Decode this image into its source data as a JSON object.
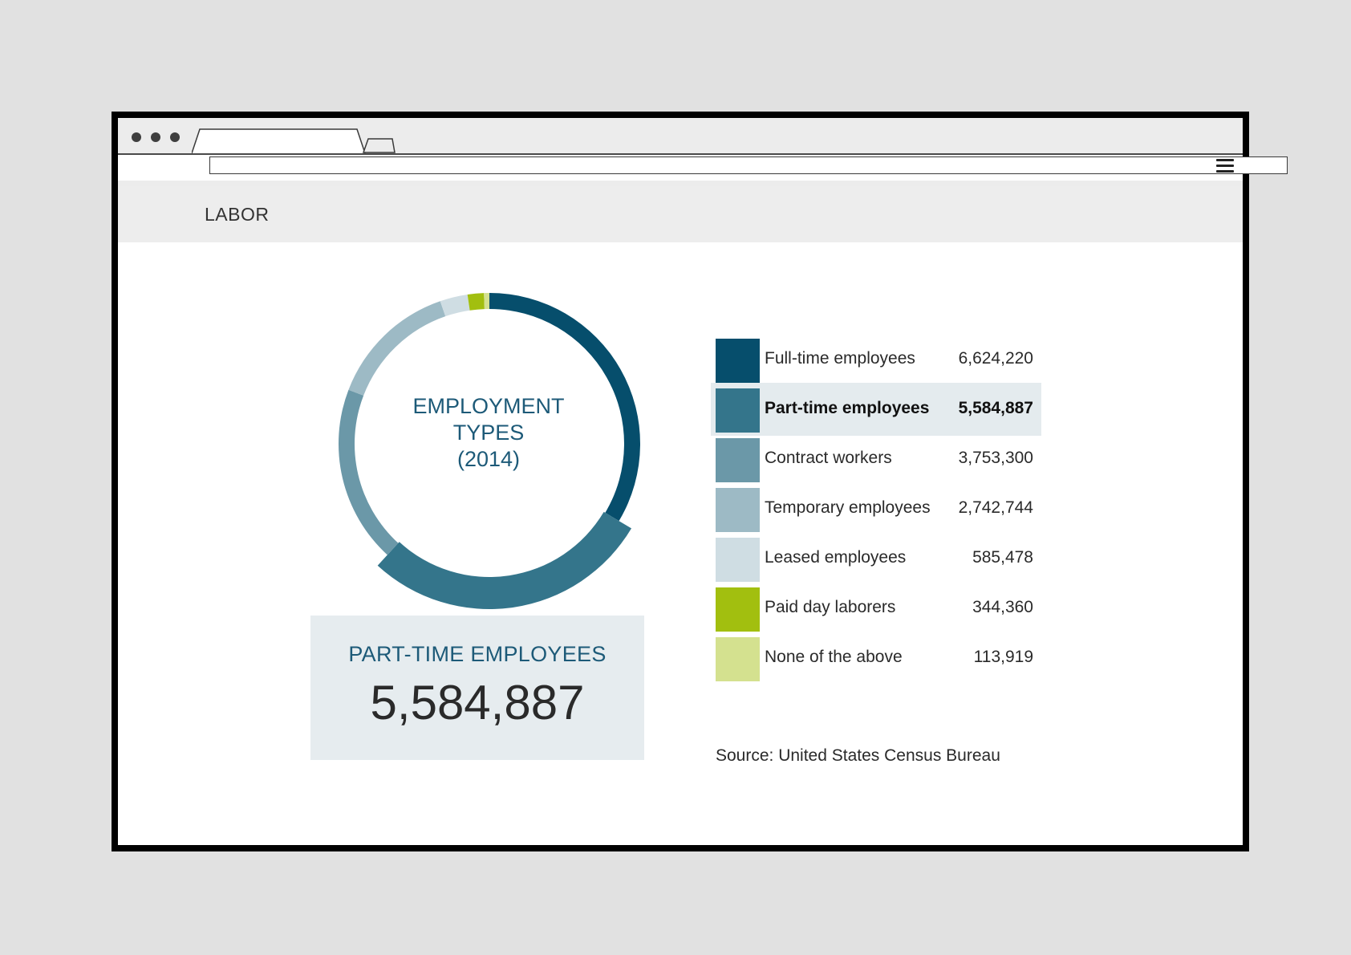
{
  "page": {
    "title": "LABOR"
  },
  "chart_data": {
    "type": "pie",
    "style": "donut",
    "title": "EMPLOYMENT TYPES (2014)",
    "title_lines": [
      "EMPLOYMENT",
      "TYPES",
      "(2014)"
    ],
    "highlighted": "Part-time employees",
    "categories": [
      "Full-time employees",
      "Part-time employees",
      "Contract workers",
      "Temporary employees",
      "Leased employees",
      "Paid day laborers",
      "None of the above"
    ],
    "values": [
      6624220,
      5584887,
      3753300,
      2742744,
      585478,
      344360,
      113919
    ],
    "value_labels": [
      "6,624,220",
      "5,584,887",
      "3,753,300",
      "2,742,744",
      "585,478",
      "344,360",
      "113,919"
    ],
    "colors": [
      "#064e6c",
      "#34758b",
      "#6b98a8",
      "#9dbac5",
      "#cfdde3",
      "#a2bf0f",
      "#d4e18f"
    ],
    "legend_position": "right"
  },
  "callout": {
    "label": "PART-TIME EMPLOYEES",
    "value": "5,584,887"
  },
  "source": "Source: United States Census Bureau"
}
